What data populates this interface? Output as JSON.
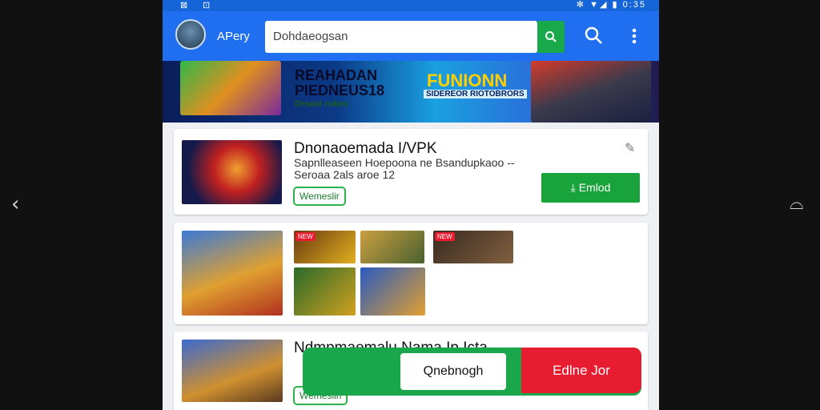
{
  "status": {
    "left_icons": "⊠",
    "left_icons2": "⊡",
    "right_icons": "✻ ▼◢ ▮ 0:35"
  },
  "nav": {
    "back_icon": "‹",
    "right_icon": "⌓"
  },
  "appbar": {
    "app_name": "APery",
    "search_value": "Dohdaeogsan"
  },
  "banner": {
    "line1": "REAHADAN",
    "line2": "PIEDNEUS18",
    "line3": "Drseat rukes",
    "right_title": "FUNIONN",
    "right_sub": "SIDEREOR RIOTOBRORS"
  },
  "card1": {
    "title": "Dnonaoemada I/VPK",
    "desc_line1": "Sapnlleaseen Hoepoona ne  Bsandupkaoo  --",
    "desc_line2": "Seroaa 2als aroe   12",
    "badge": "Wemeslir",
    "install_label": "Emlod"
  },
  "card2": {
    "tags": [
      "NEW",
      "NEW"
    ]
  },
  "card3": {
    "title": "Ndmpmaemalu Nama Ip Icta",
    "badge": "Wemeslin"
  },
  "actionbar": {
    "open_label": "Qnebnogh",
    "download_label": "Edlne Jor"
  },
  "colors": {
    "primary": "#1f6ff0",
    "install": "#18a43b",
    "download": "#e81c30"
  }
}
